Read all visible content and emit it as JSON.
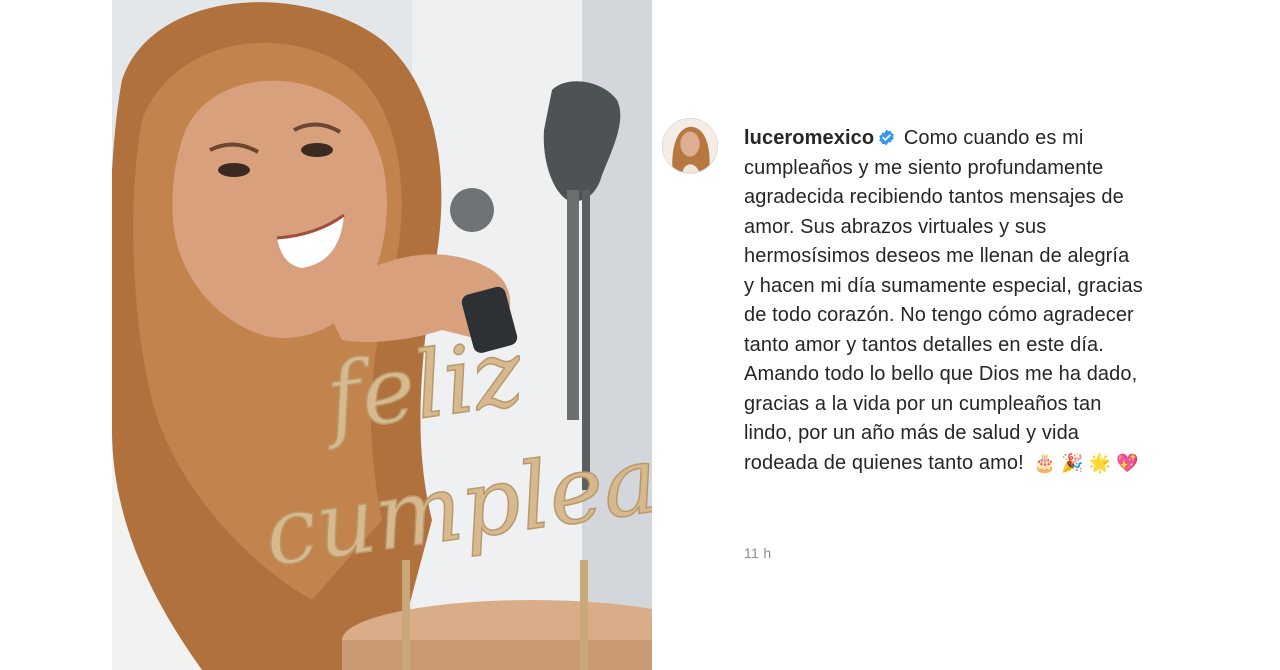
{
  "post": {
    "username": "luceromexico",
    "verified": true,
    "caption": "Como cuando es mi cumpleaños y me siento profundamente agradecida recibiendo tantos mensajes de amor. Sus abrazos virtuales y sus hermosísimos deseos me llenan de alegría y hacen mi día sumamente especial, gracias de todo corazón. No tengo cómo agradecer tanto amor y tantos detalles en este día. Amando todo lo bello que Dios me ha dado, gracias a la vida por un cumpleaños tan lindo, por un año más de salud y vida rodeada de quienes tanto amo!",
    "emojis": "🎂 🎉 🌟 💖",
    "timestamp": "11 h",
    "photo_topper_text": "feliz cumpleañ"
  },
  "colors": {
    "verified_badge": "#3897f0",
    "timestamp": "#8e8e8e",
    "text": "#262626"
  }
}
